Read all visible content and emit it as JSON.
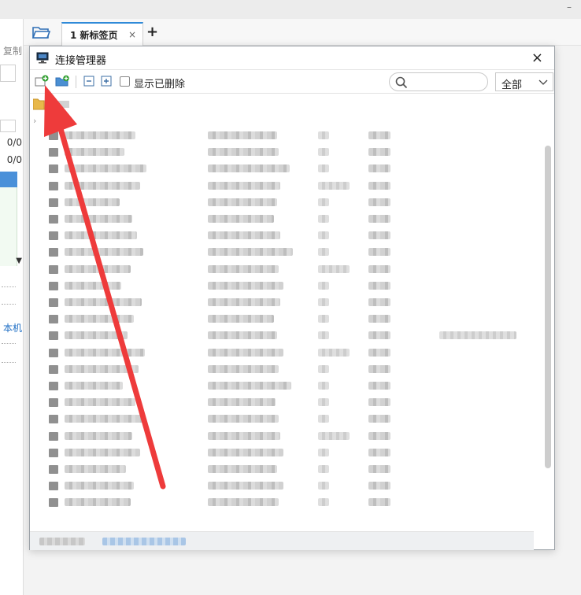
{
  "window": {
    "minimize_glyph": "–"
  },
  "tabs": [
    {
      "label": "1 新标签页",
      "close": "×"
    }
  ],
  "tab_add_label": "+",
  "left_pane": {
    "top_label": "复制",
    "values": [
      "0/0",
      "0/0"
    ],
    "this_machine_label": "本机",
    "dropdown_glyph": "▼",
    "menu_glyph": "⋮"
  },
  "dialog": {
    "title": "连接管理器",
    "close_glyph": "×",
    "toolbar": {
      "show_deleted_label": "显示已删除",
      "show_deleted_checked": false,
      "search_placeholder": "",
      "filter_value": "全部"
    }
  },
  "annotation": {
    "color": "#ee3b3b",
    "description": "red arrow pointing to new-connection button"
  },
  "icons": [
    "new-connection-icon",
    "new-folder-icon",
    "collapse-all-icon",
    "expand-all-icon",
    "search-icon",
    "chevron-down-icon",
    "folder-icon",
    "close-icon"
  ]
}
